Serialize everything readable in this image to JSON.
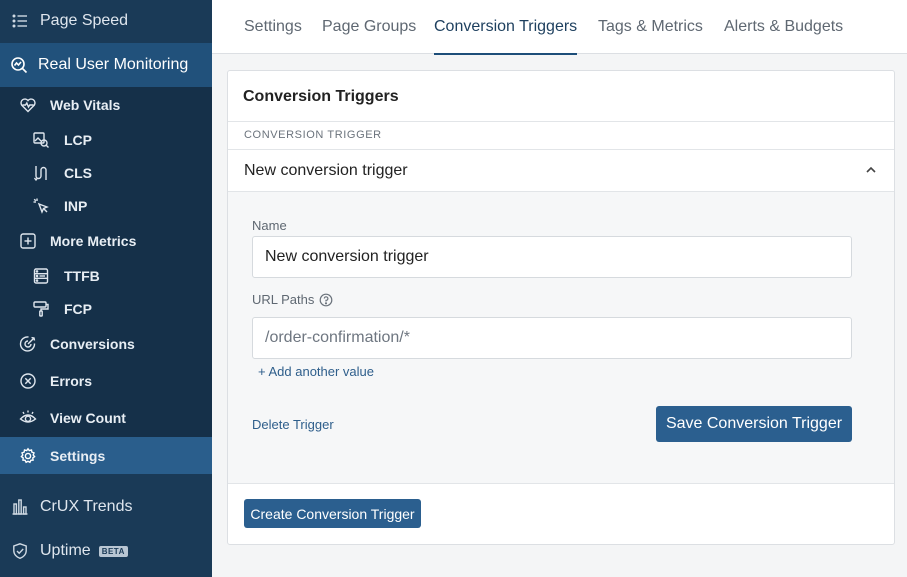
{
  "sidebar": {
    "top_item": {
      "label": "Page Speed",
      "icon": "list-icon"
    },
    "section": {
      "label": "Real User Monitoring",
      "icon": "search-chart-icon"
    },
    "items": [
      {
        "label": "Web Vitals",
        "icon": "heart-pulse-icon",
        "level": 1
      },
      {
        "label": "LCP",
        "icon": "image-search-icon",
        "level": 2
      },
      {
        "label": "CLS",
        "icon": "layout-shift-icon",
        "level": 2
      },
      {
        "label": "INP",
        "icon": "pointer-click-icon",
        "level": 2
      },
      {
        "label": "More Metrics",
        "icon": "plus-square-icon",
        "level": 1
      },
      {
        "label": "TTFB",
        "icon": "server-icon",
        "level": 2
      },
      {
        "label": "FCP",
        "icon": "paint-roller-icon",
        "level": 2
      },
      {
        "label": "Conversions",
        "icon": "target-icon",
        "level": 1
      },
      {
        "label": "Errors",
        "icon": "x-circle-icon",
        "level": 1
      },
      {
        "label": "View Count",
        "icon": "eye-icon",
        "level": 1
      },
      {
        "label": "Settings",
        "icon": "gear-icon",
        "level": 1,
        "active": true
      }
    ],
    "bottom_items": [
      {
        "label": "CrUX Trends",
        "icon": "bar-chart-icon"
      },
      {
        "label": "Uptime",
        "icon": "shield-check-icon",
        "badge": "BETA"
      }
    ]
  },
  "tabs": [
    {
      "label": "Settings",
      "active": false
    },
    {
      "label": "Page Groups",
      "active": false
    },
    {
      "label": "Conversion Triggers",
      "active": true
    },
    {
      "label": "Tags & Metrics",
      "active": false
    },
    {
      "label": "Alerts & Budgets",
      "active": false
    }
  ],
  "card": {
    "title": "Conversion Triggers",
    "section_label": "CONVERSION TRIGGER",
    "trigger": {
      "header": "New conversion trigger",
      "name_label": "Name",
      "name_value": "New conversion trigger",
      "url_paths_label": "URL Paths",
      "url_paths_placeholder": "/order-confirmation/*",
      "add_value_link": "+ Add another value",
      "delete_link": "Delete Trigger",
      "save_button": "Save Conversion Trigger"
    },
    "create_button": "Create Conversion Trigger"
  },
  "colors": {
    "sidebar_bg": "#1a3a57",
    "sidebar_active": "#2a5e8c",
    "primary_button": "#2b5f8f",
    "link": "#2e5e8b"
  }
}
